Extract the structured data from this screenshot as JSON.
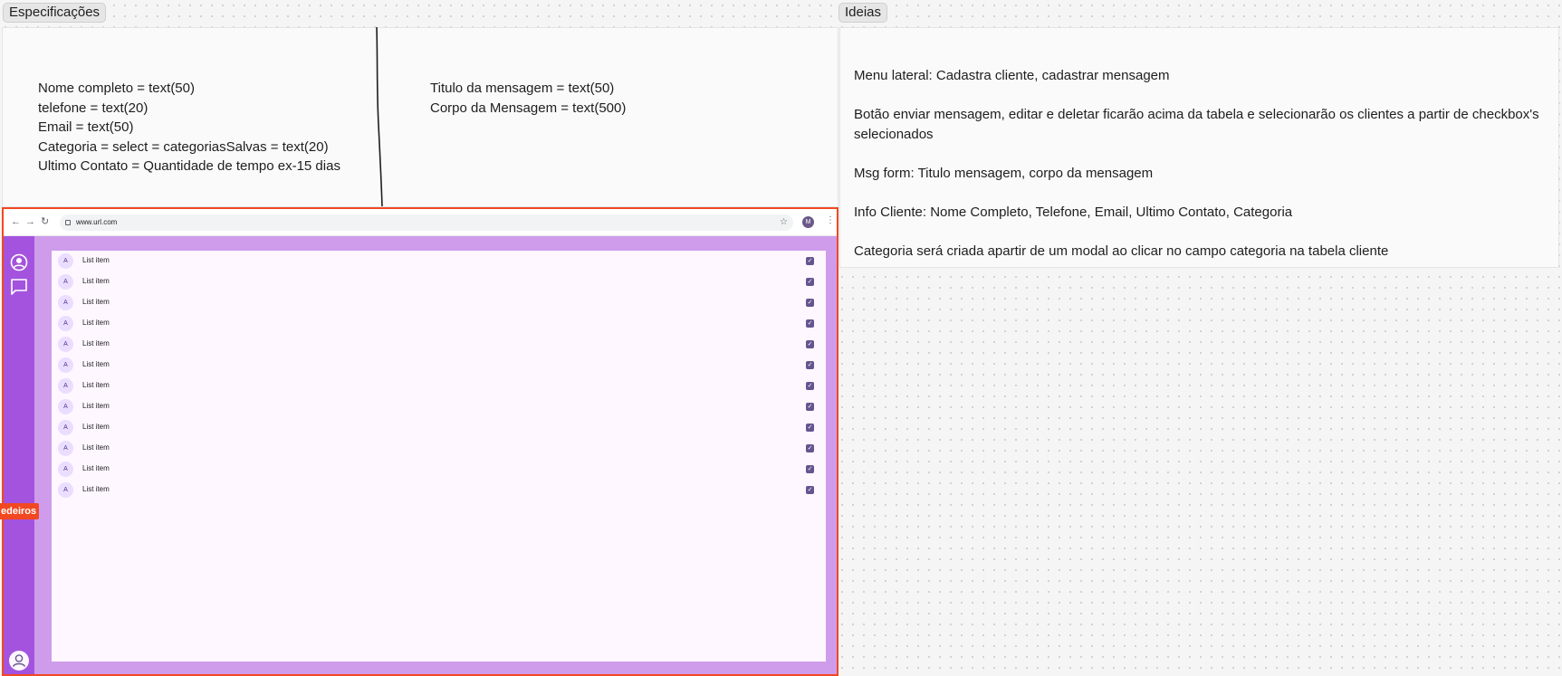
{
  "frames": {
    "specs_label": "Especificações",
    "ideas_label": "Ideias"
  },
  "specs": {
    "left_fields": [
      "Nome completo = text(50)",
      "telefone = text(20)",
      "Email = text(50)",
      "Categoria = select = categoriasSalvas = text(20)",
      "Ultimo Contato = Quantidade de tempo ex-15 dias"
    ],
    "right_fields": [
      "Titulo da mensagem = text(50)",
      "Corpo da Mensagem = text(500)"
    ]
  },
  "ideas": [
    "Menu lateral: Cadastra cliente, cadastrar mensagem",
    "Botão enviar mensagem,  editar e deletar ficarão acima da tabela e selecionarão os clientes a partir de checkbox's selecionados",
    "Msg form: Titulo mensagem, corpo da mensagem",
    "Info Cliente: Nome Completo, Telefone, Email, Ultimo Contato, Categoria",
    "Categoria será criada apartir de um modal ao clicar no campo categoria na tabela cliente"
  ],
  "browser": {
    "url": "www.url.com",
    "profile_initial": "M",
    "list_items": [
      {
        "avatar": "A",
        "label": "List item",
        "checked": true
      },
      {
        "avatar": "A",
        "label": "List item",
        "checked": true
      },
      {
        "avatar": "A",
        "label": "List item",
        "checked": true
      },
      {
        "avatar": "A",
        "label": "List item",
        "checked": true
      },
      {
        "avatar": "A",
        "label": "List item",
        "checked": true
      },
      {
        "avatar": "A",
        "label": "List item",
        "checked": true
      },
      {
        "avatar": "A",
        "label": "List item",
        "checked": true
      },
      {
        "avatar": "A",
        "label": "List item",
        "checked": true
      },
      {
        "avatar": "A",
        "label": "List item",
        "checked": true
      },
      {
        "avatar": "A",
        "label": "List item",
        "checked": true
      },
      {
        "avatar": "A",
        "label": "List item",
        "checked": true
      },
      {
        "avatar": "A",
        "label": "List item",
        "checked": true
      }
    ]
  },
  "tag": {
    "label": "edeiros"
  },
  "colors": {
    "selection": "#f24822",
    "sidebar": "#a453de",
    "content_bg": "#cf9cec",
    "list_bg": "#fef7ff",
    "checkbox": "#65558f"
  }
}
